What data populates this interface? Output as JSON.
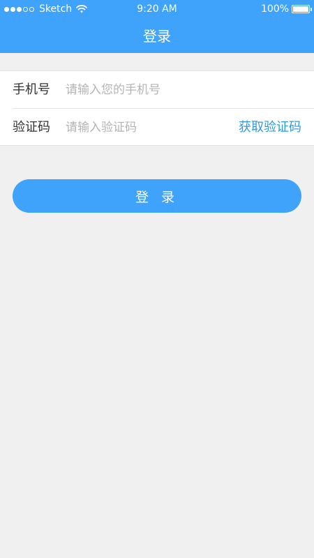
{
  "status_bar": {
    "signal_dots": [
      "full",
      "full",
      "full",
      "empty",
      "empty"
    ],
    "carrier": "Sketch",
    "wifi_icon": "wifi-icon",
    "time": "9:20 AM",
    "battery_percent": "100%",
    "battery_level": 1.0
  },
  "nav": {
    "title": "登录"
  },
  "form": {
    "phone": {
      "label": "手机号",
      "placeholder": "请输入您的手机号",
      "value": ""
    },
    "code": {
      "label": "验证码",
      "placeholder": "请输入验证码",
      "value": "",
      "get_code_label": "获取验证码"
    }
  },
  "login_button": {
    "label": "登 录"
  },
  "colors": {
    "primary": "#3fa2fb",
    "link": "#2e9ae8",
    "background": "#f0f0f0"
  }
}
